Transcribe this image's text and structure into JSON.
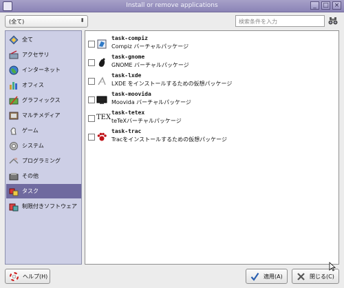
{
  "window": {
    "title": "Install or remove applications"
  },
  "filter": {
    "value": "(全て)"
  },
  "search": {
    "placeholder": "検索条件を入力"
  },
  "sidebar": {
    "items": [
      {
        "label": "全て",
        "icon": "all-apps-icon"
      },
      {
        "label": "アクセサリ",
        "icon": "accessories-icon"
      },
      {
        "label": "インターネット",
        "icon": "globe-icon"
      },
      {
        "label": "オフィス",
        "icon": "office-icon"
      },
      {
        "label": "グラフィックス",
        "icon": "graphics-icon"
      },
      {
        "label": "マルチメディア",
        "icon": "multimedia-icon"
      },
      {
        "label": "ゲーム",
        "icon": "game-icon"
      },
      {
        "label": "システム",
        "icon": "system-icon"
      },
      {
        "label": "プログラミング",
        "icon": "programming-icon"
      },
      {
        "label": "その他",
        "icon": "other-icon"
      },
      {
        "label": "タスク",
        "icon": "task-icon",
        "selected": true
      },
      {
        "label": "制限付きソフトウェア",
        "icon": "restricted-icon"
      }
    ]
  },
  "packages": [
    {
      "name": "task-compiz",
      "desc": "Compiz バーチャルパッケージ",
      "icon": "compiz-icon",
      "checked": false
    },
    {
      "name": "task-gnome",
      "desc": "GNOME バーチャルパッケージ",
      "icon": "gnome-icon",
      "checked": false
    },
    {
      "name": "task-lxde",
      "desc": "LXDE をインストールするための仮想パッケージ",
      "icon": "lxde-icon",
      "checked": false
    },
    {
      "name": "task-moovida",
      "desc": "Moovida バーチャルパッケージ",
      "icon": "moovida-icon",
      "checked": false
    },
    {
      "name": "task-tetex",
      "desc": "teTeXバーチャルパッケージ",
      "icon": "tex-icon",
      "checked": false
    },
    {
      "name": "task-trac",
      "desc": "Tracをインストールするための仮想パッケージ",
      "icon": "trac-icon",
      "checked": false
    }
  ],
  "tex_logo_text": "TEX",
  "buttons": {
    "help": "ヘルプ(H)",
    "apply": "適用(A)",
    "close": "閉じる(C)"
  },
  "colors": {
    "titlebar": "#8b84b6",
    "selection": "#6f6a9f",
    "sidebar_bg": "#cdcfe6"
  }
}
